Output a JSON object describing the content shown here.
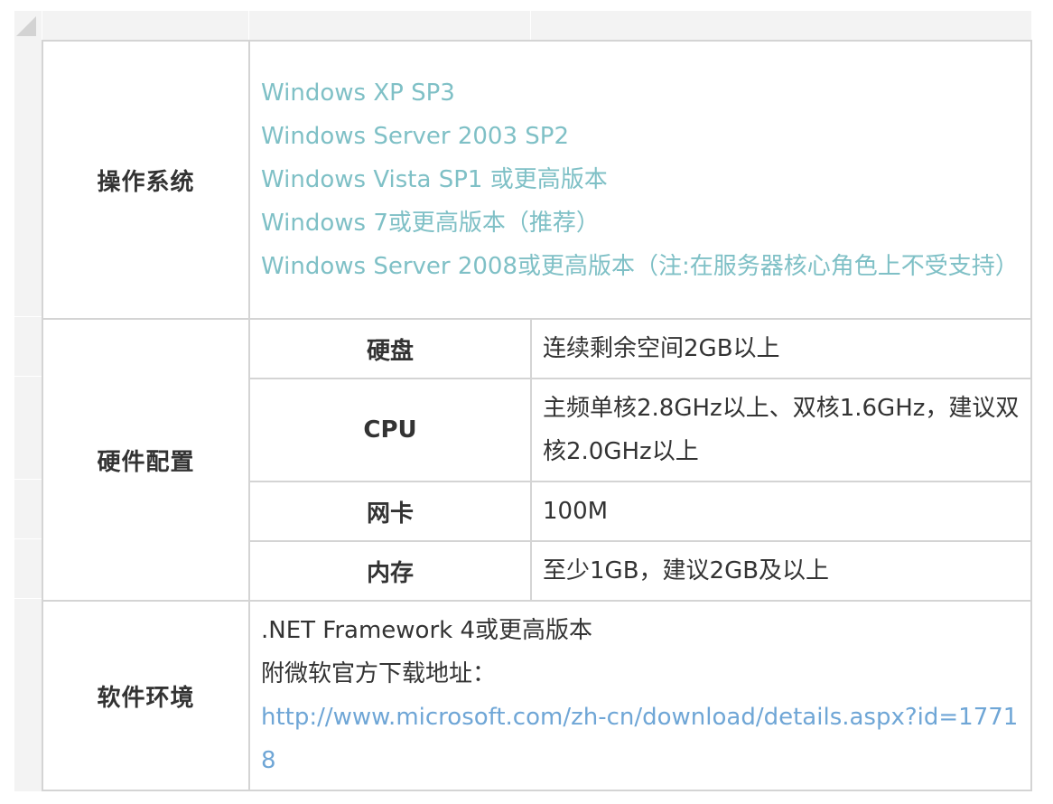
{
  "os": {
    "category": "操作系统",
    "items": [
      "Windows XP SP3",
      "Windows Server 2003 SP2",
      "Windows Vista SP1 或更高版本",
      "Windows 7或更高版本（推荐）",
      "Windows Server 2008或更高版本（注:在服务器核心角色上不受支持）"
    ]
  },
  "hardware": {
    "category": "硬件配置",
    "rows": [
      {
        "label": "硬盘",
        "value": "连续剩余空间2GB以上"
      },
      {
        "label": "CPU",
        "value": "主频单核2.8GHz以上、双核1.6GHz，建议双核2.0GHz以上"
      },
      {
        "label": "网卡",
        "value": "100M"
      },
      {
        "label": "内存",
        "value": "至少1GB，建议2GB及以上"
      }
    ]
  },
  "software": {
    "category": "软件环境",
    "framework": ".NET Framework 4或更高版本",
    "download_label": "附微软官方下载地址：",
    "download_url": "http://www.microsoft.com/zh-cn/download/details.aspx?id=17718"
  },
  "colors": {
    "category_text": "#b0302a",
    "os_text": "#7fc0c6",
    "link_text": "#6fa6d6",
    "border": "#d4d4d4"
  }
}
